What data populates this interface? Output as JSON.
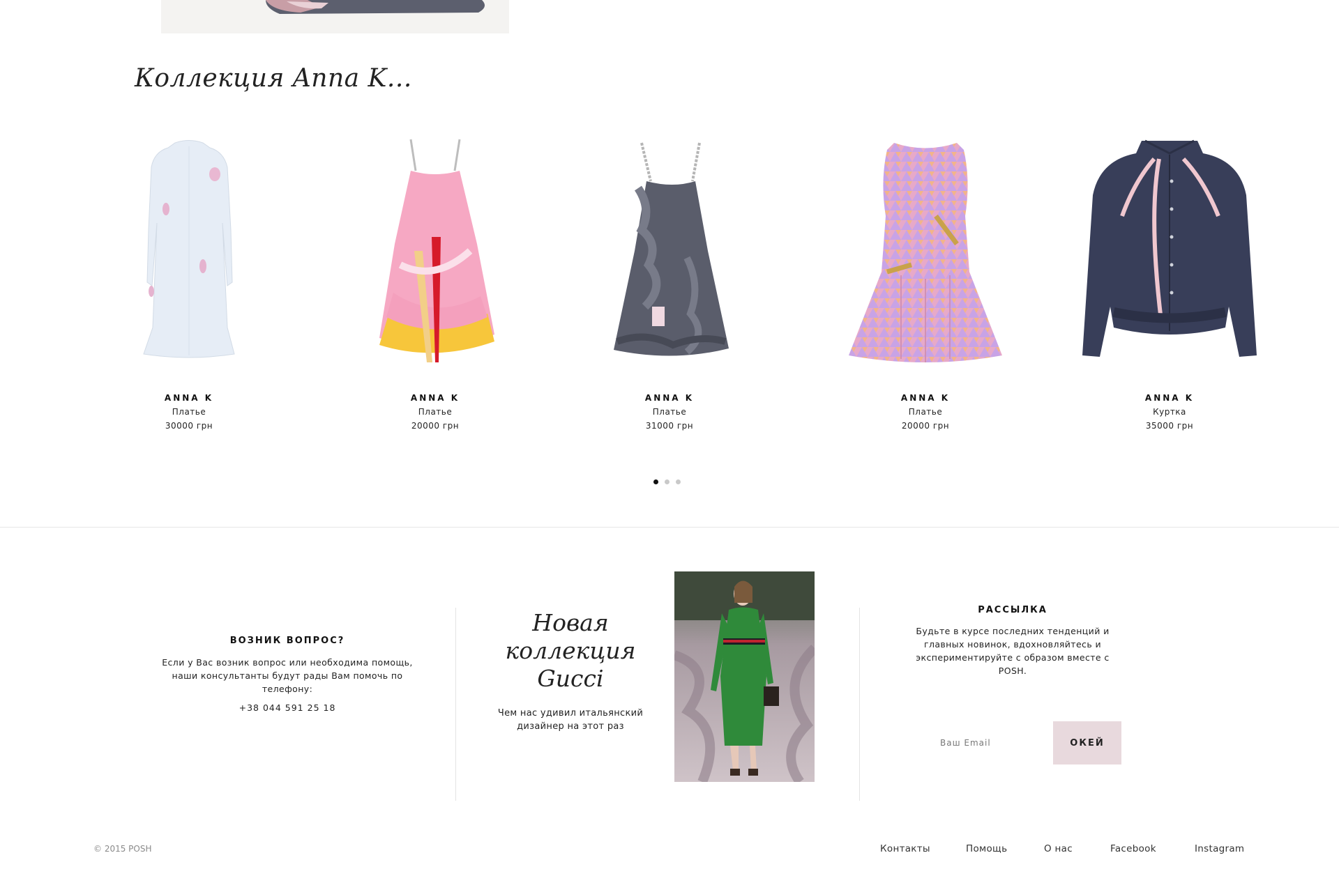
{
  "collection": {
    "title": "Коллекция Anna K...",
    "products": [
      {
        "brand": "ANNA K",
        "type": "Платье",
        "price": "30000 грн"
      },
      {
        "brand": "ANNA K",
        "type": "Платье",
        "price": "20000 грн"
      },
      {
        "brand": "ANNA K",
        "type": "Платье",
        "price": "31000 грн"
      },
      {
        "brand": "ANNA K",
        "type": "Платье",
        "price": "20000 грн"
      },
      {
        "brand": "ANNA K",
        "type": "Куртка",
        "price": "35000 грн"
      }
    ],
    "carousel": {
      "pages": 3,
      "active_page": 1
    }
  },
  "help": {
    "title": "ВОЗНИК ВОПРОС?",
    "text": "Если у Вас возник вопрос или необходима помощь, наши консультанты будут рады Вам помочь по телефону:",
    "phone": "+38 044 591 25 18"
  },
  "promo": {
    "title_line1": "Новая",
    "title_line2": "коллекция",
    "title_line3": "Gucci",
    "text": "Чем нас удивил итальянский дизайнер на этот раз"
  },
  "newsletter": {
    "title": "РАССЫЛКА",
    "text": "Будьте в курсе последних тенденций и главных новинок, вдохновляйтесь и экспериментируйте с образом вместе с POSH.",
    "email_placeholder": "Ваш Email",
    "button_label": "ОКЕЙ"
  },
  "footer": {
    "copyright": "© 2015 POSH",
    "links": {
      "contacts": "Контакты",
      "help": "Помощь",
      "about": "О нас",
      "facebook": "Facebook",
      "instagram": "Instagram"
    }
  },
  "colors": {
    "accent_button": "#e8d9dd",
    "divider": "#e6e6e6",
    "text": "#111111"
  }
}
